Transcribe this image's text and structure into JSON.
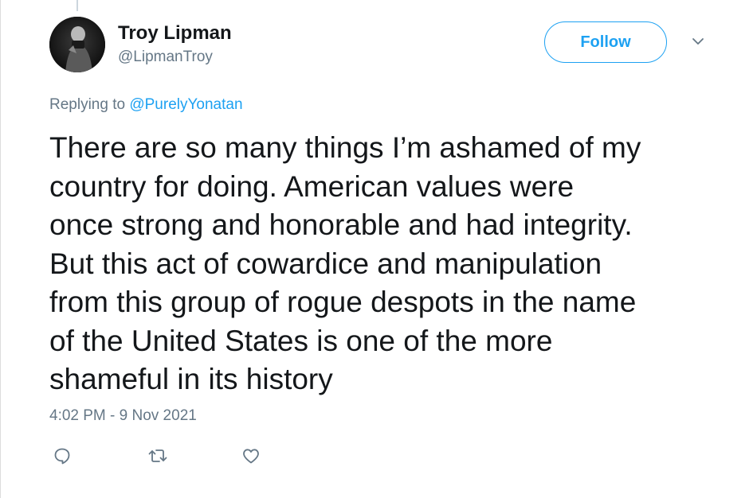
{
  "author": {
    "display_name": "Troy Lipman",
    "handle": "@LipmanTroy",
    "follow_label": "Follow"
  },
  "reply": {
    "prefix": "Replying to ",
    "mention": "@PurelyYonatan"
  },
  "tweet": {
    "lines": [
      "There are so many things I’m ashamed of my",
      "country for doing. American values were",
      "once strong and honorable and had integrity.",
      "But this act of cowardice and manipulation",
      "from this group of rogue despots in the name",
      "of the United States is one of the more",
      "shameful in its history"
    ],
    "timestamp": "4:02 PM - 9 Nov 2021"
  },
  "icons": {
    "caret": "chevron-down-icon",
    "reply": "reply-icon",
    "retweet": "retweet-icon",
    "like": "like-icon"
  },
  "colors": {
    "accent": "#1da1f2",
    "secondary_text": "#657786",
    "primary_text": "#14171a"
  }
}
